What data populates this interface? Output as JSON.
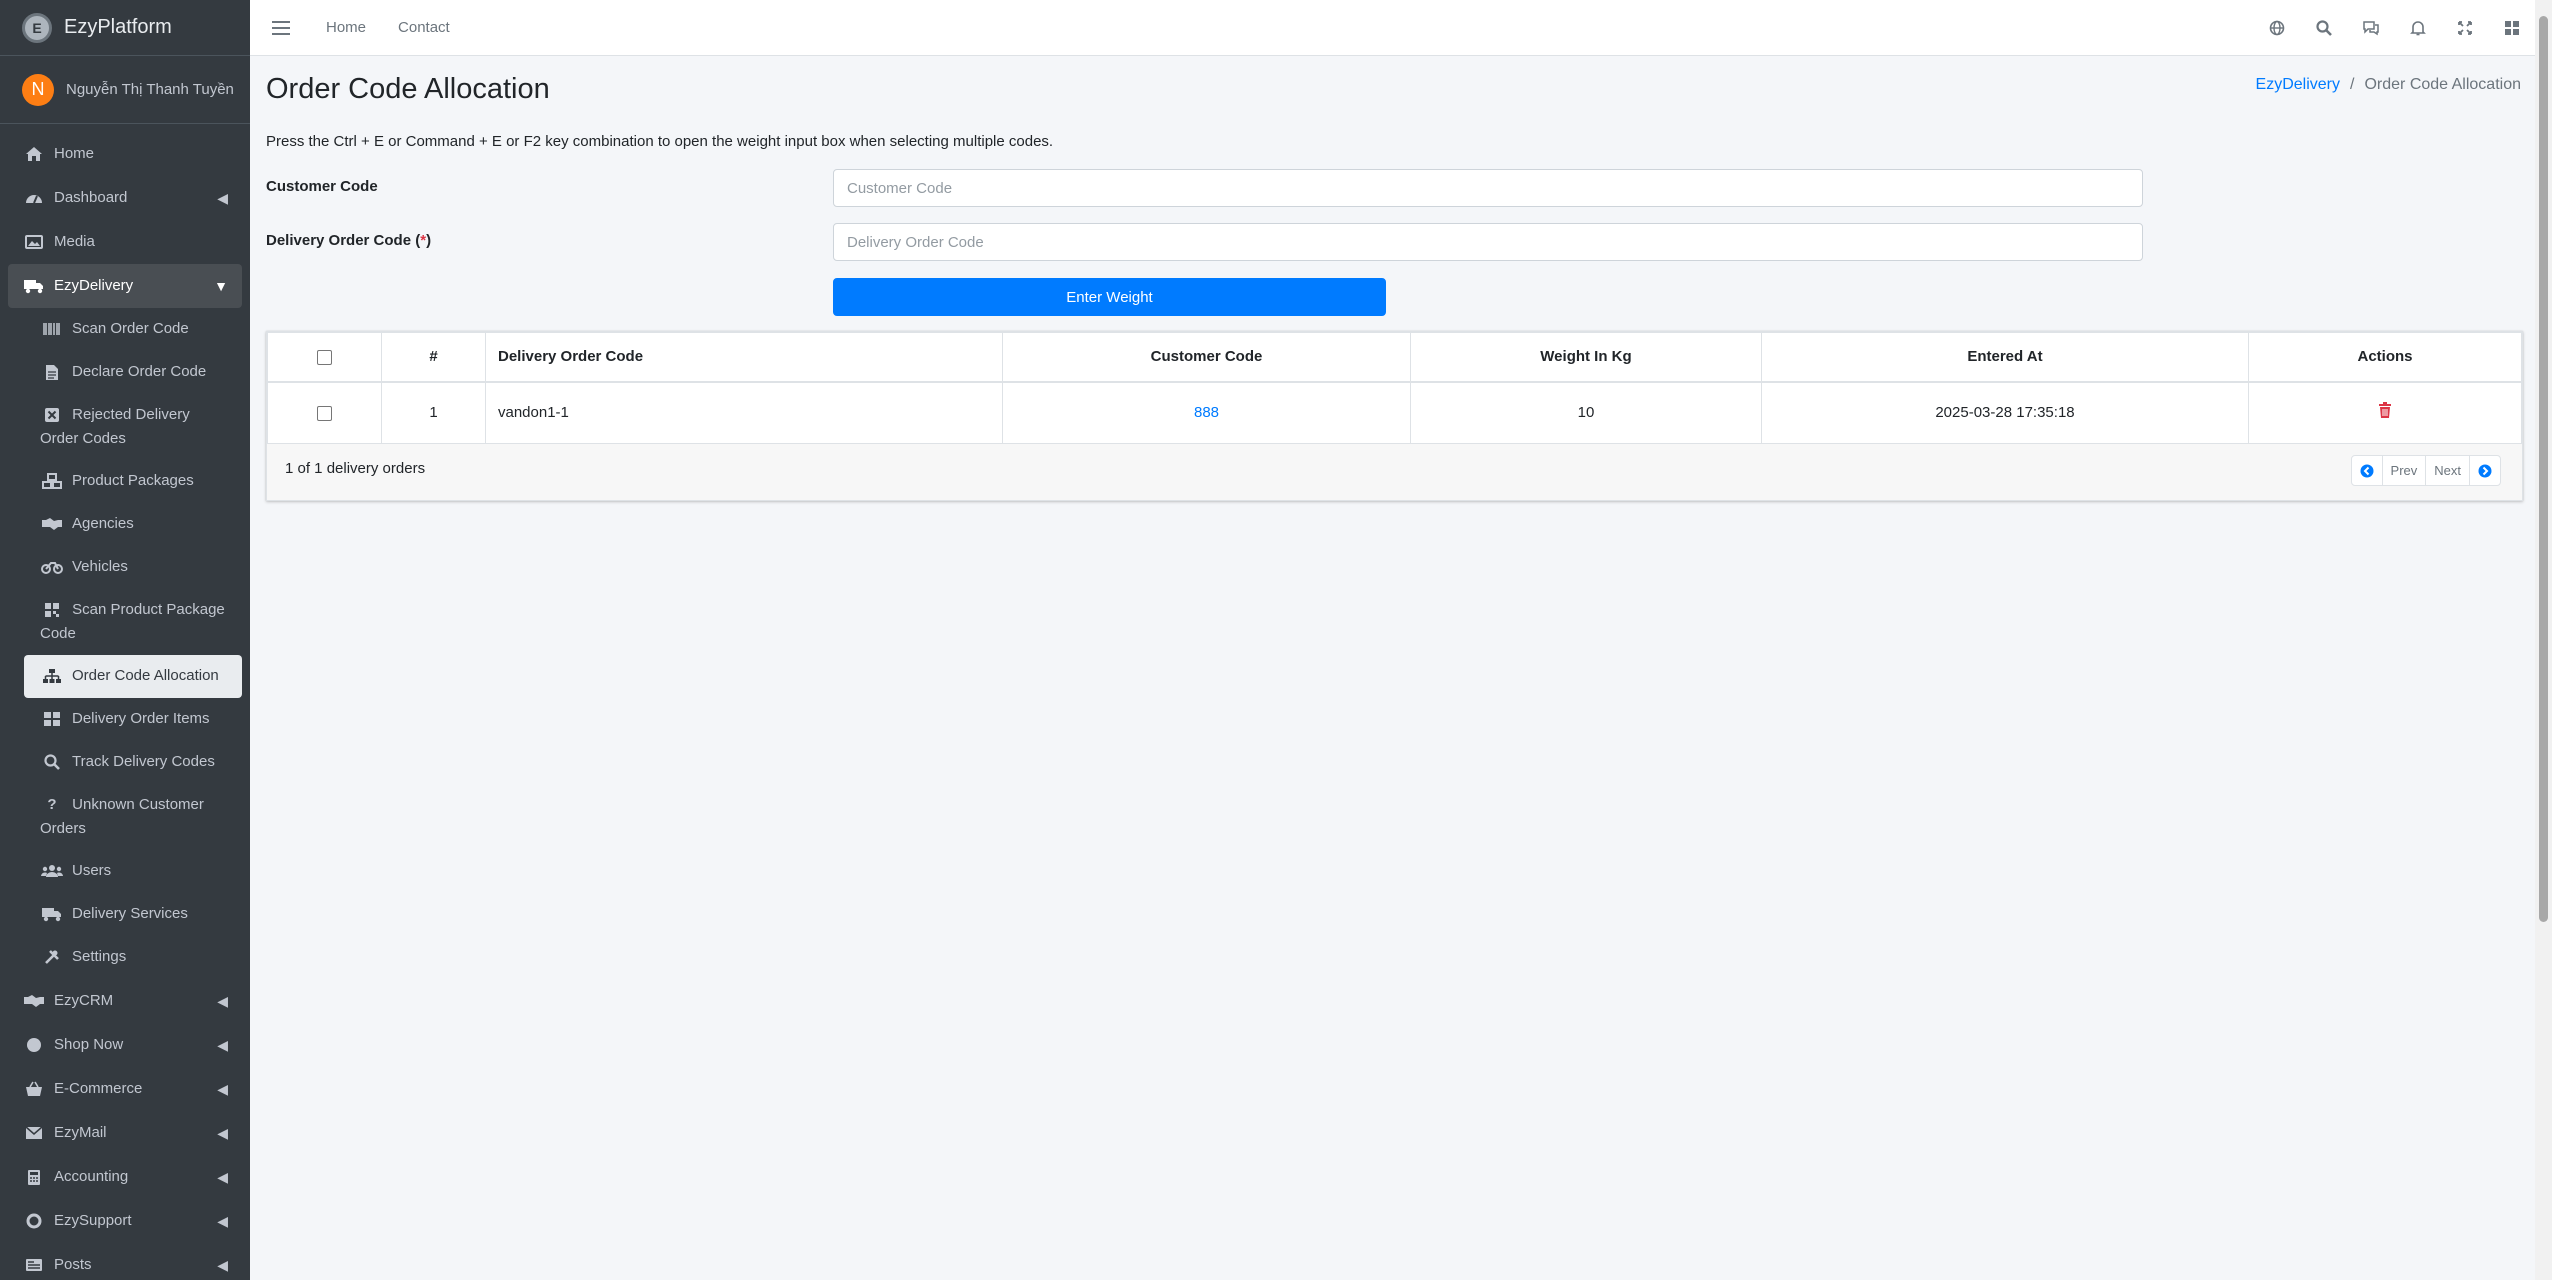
{
  "brand": {
    "name": "EzyPlatform"
  },
  "user": {
    "initial": "N",
    "name": "Nguyễn Thị Thanh Tuyền"
  },
  "sidebar": {
    "items": [
      {
        "label": "Home",
        "icon": "home-icon"
      },
      {
        "label": "Dashboard",
        "icon": "dashboard-icon",
        "has_children": true
      },
      {
        "label": "Media",
        "icon": "image-icon"
      },
      {
        "label": "EzyDelivery",
        "icon": "truck-icon",
        "open": true
      }
    ],
    "sub_items": [
      {
        "label": "Scan Order Code",
        "icon": "barcode-icon"
      },
      {
        "label": "Declare Order Code",
        "icon": "file-icon"
      },
      {
        "label": "Rejected Delivery Order Codes",
        "icon": "reject-icon"
      },
      {
        "label": "Product Packages",
        "icon": "boxes-icon"
      },
      {
        "label": "Agencies",
        "icon": "handshake-icon"
      },
      {
        "label": "Vehicles",
        "icon": "motorcycle-icon"
      },
      {
        "label": "Scan Product Package Code",
        "icon": "qrcode-icon"
      },
      {
        "label": "Order Code Allocation",
        "icon": "sitemap-icon",
        "active": true
      },
      {
        "label": "Delivery Order Items",
        "icon": "grid-icon"
      },
      {
        "label": "Track Delivery Codes",
        "icon": "search-icon"
      },
      {
        "label": "Unknown Customer Orders",
        "icon": "question-icon"
      },
      {
        "label": "Users",
        "icon": "users-icon"
      },
      {
        "label": "Delivery Services",
        "icon": "truck-icon"
      },
      {
        "label": "Settings",
        "icon": "tools-icon"
      }
    ],
    "bottom_items": [
      {
        "label": "EzyCRM",
        "icon": "handshake-icon"
      },
      {
        "label": "Shop Now",
        "icon": "circle-icon"
      },
      {
        "label": "E-Commerce",
        "icon": "basket-icon"
      },
      {
        "label": "EzyMail",
        "icon": "envelope-icon"
      },
      {
        "label": "Accounting",
        "icon": "calculator-icon"
      },
      {
        "label": "EzySupport",
        "icon": "lifering-icon"
      },
      {
        "label": "Posts",
        "icon": "newspaper-icon"
      }
    ]
  },
  "topbar": {
    "links": [
      "Home",
      "Contact"
    ]
  },
  "page": {
    "title": "Order Code Allocation",
    "breadcrumb": {
      "parent": "EzyDelivery",
      "separator": "/",
      "current": "Order Code Allocation"
    },
    "hint": "Press the Ctrl + E or Command + E or F2 key combination to open the weight input box when selecting multiple codes."
  },
  "form": {
    "customer_code": {
      "label": "Customer Code",
      "placeholder": "Customer Code",
      "value": ""
    },
    "delivery_order_code": {
      "label": "Delivery Order Code (",
      "required_mark": "*",
      "label_end": ")",
      "placeholder": "Delivery Order Code",
      "value": ""
    },
    "submit_label": "Enter Weight"
  },
  "table": {
    "headers": [
      "#",
      "Delivery Order Code",
      "Customer Code",
      "Weight In Kg",
      "Entered At",
      "Actions"
    ],
    "rows": [
      {
        "index": "1",
        "delivery_order_code": "vandon1-1",
        "customer_code": "888",
        "weight": "10",
        "entered_at": "2025-03-28 17:35:18"
      }
    ],
    "summary": "1 of 1 delivery orders",
    "pager": {
      "prev": "Prev",
      "next": "Next"
    }
  },
  "colors": {
    "accent": "#007bff",
    "danger": "#dc3545",
    "sidebar_bg": "#343a40",
    "avatar": "#fd7e14"
  }
}
